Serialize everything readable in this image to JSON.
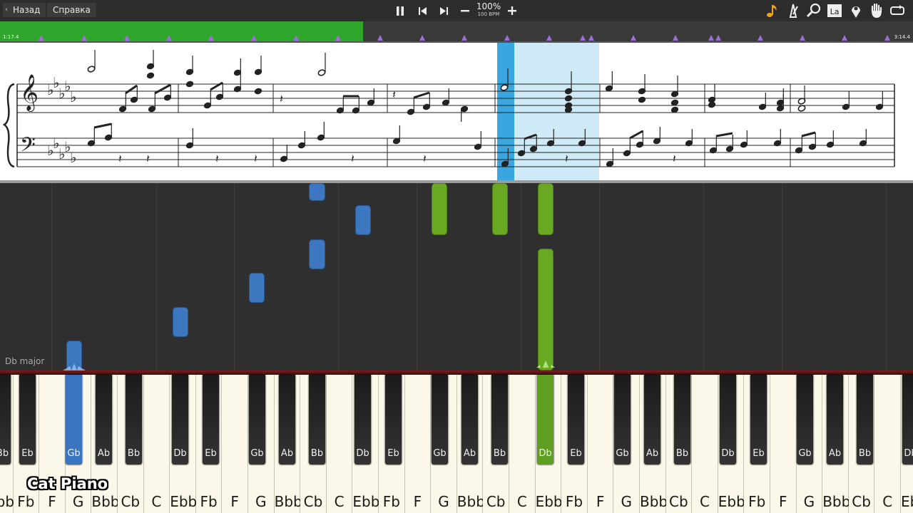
{
  "toolbar": {
    "back_label": "Назад",
    "help_label": "Справка",
    "tempo_percent": "100%",
    "tempo_bpm": "100 BPM",
    "controls": [
      "pause-icon",
      "previous-icon",
      "next-icon",
      "minus-icon",
      "plus-icon"
    ],
    "right_icons": [
      "music-note-icon",
      "metronome-icon",
      "magnifier-icon",
      "note-labels-icon",
      "location-pin-icon",
      "hand-icon",
      "loop-icon"
    ],
    "note_labels_text": "La"
  },
  "timeline": {
    "elapsed": "1:17.4",
    "total": "3:14.4",
    "progress": 0.398,
    "progress_color": "#2fa52b",
    "marker_color": "#9b6fd6"
  },
  "score": {
    "key_signature": "Db major, 5 flats",
    "highlight_color": "#cfeaf7",
    "cursor_color": "#3aa6e0"
  },
  "piano_roll": {
    "key_label": "Db major",
    "left_hand_color": "#3c77bf",
    "right_hand_color": "#69a822"
  },
  "keyboard": {
    "white_keys": [
      "Ebb",
      "Fb",
      "F",
      "G",
      "Bbb",
      "Cb",
      "C",
      "Ebb",
      "Fb",
      "F",
      "G",
      "Bbb",
      "Cb",
      "C",
      "Ebb",
      "Fb",
      "F",
      "G",
      "Bbb",
      "Cb",
      "C",
      "Ebb",
      "Fb",
      "F",
      "G",
      "Bbb",
      "Cb",
      "C",
      "Ebb",
      "Fb",
      "F",
      "G",
      "Bbb",
      "Cb",
      "C",
      "Ebb",
      "Fb"
    ],
    "black_keys": [
      "Bb",
      "Eb",
      "Gb",
      "Ab",
      "Bb",
      "Db",
      "Eb",
      "Gb",
      "Ab",
      "Bb",
      "Db",
      "Eb",
      "Gb",
      "Ab",
      "Bb",
      "Db",
      "Eb",
      "Gb",
      "Ab",
      "Bb",
      "Db",
      "Eb",
      "Gb",
      "Ab",
      "Bb",
      "Db"
    ],
    "pressed_black": [
      "Gb",
      "Db"
    ]
  },
  "watermark": "Cat Piano"
}
